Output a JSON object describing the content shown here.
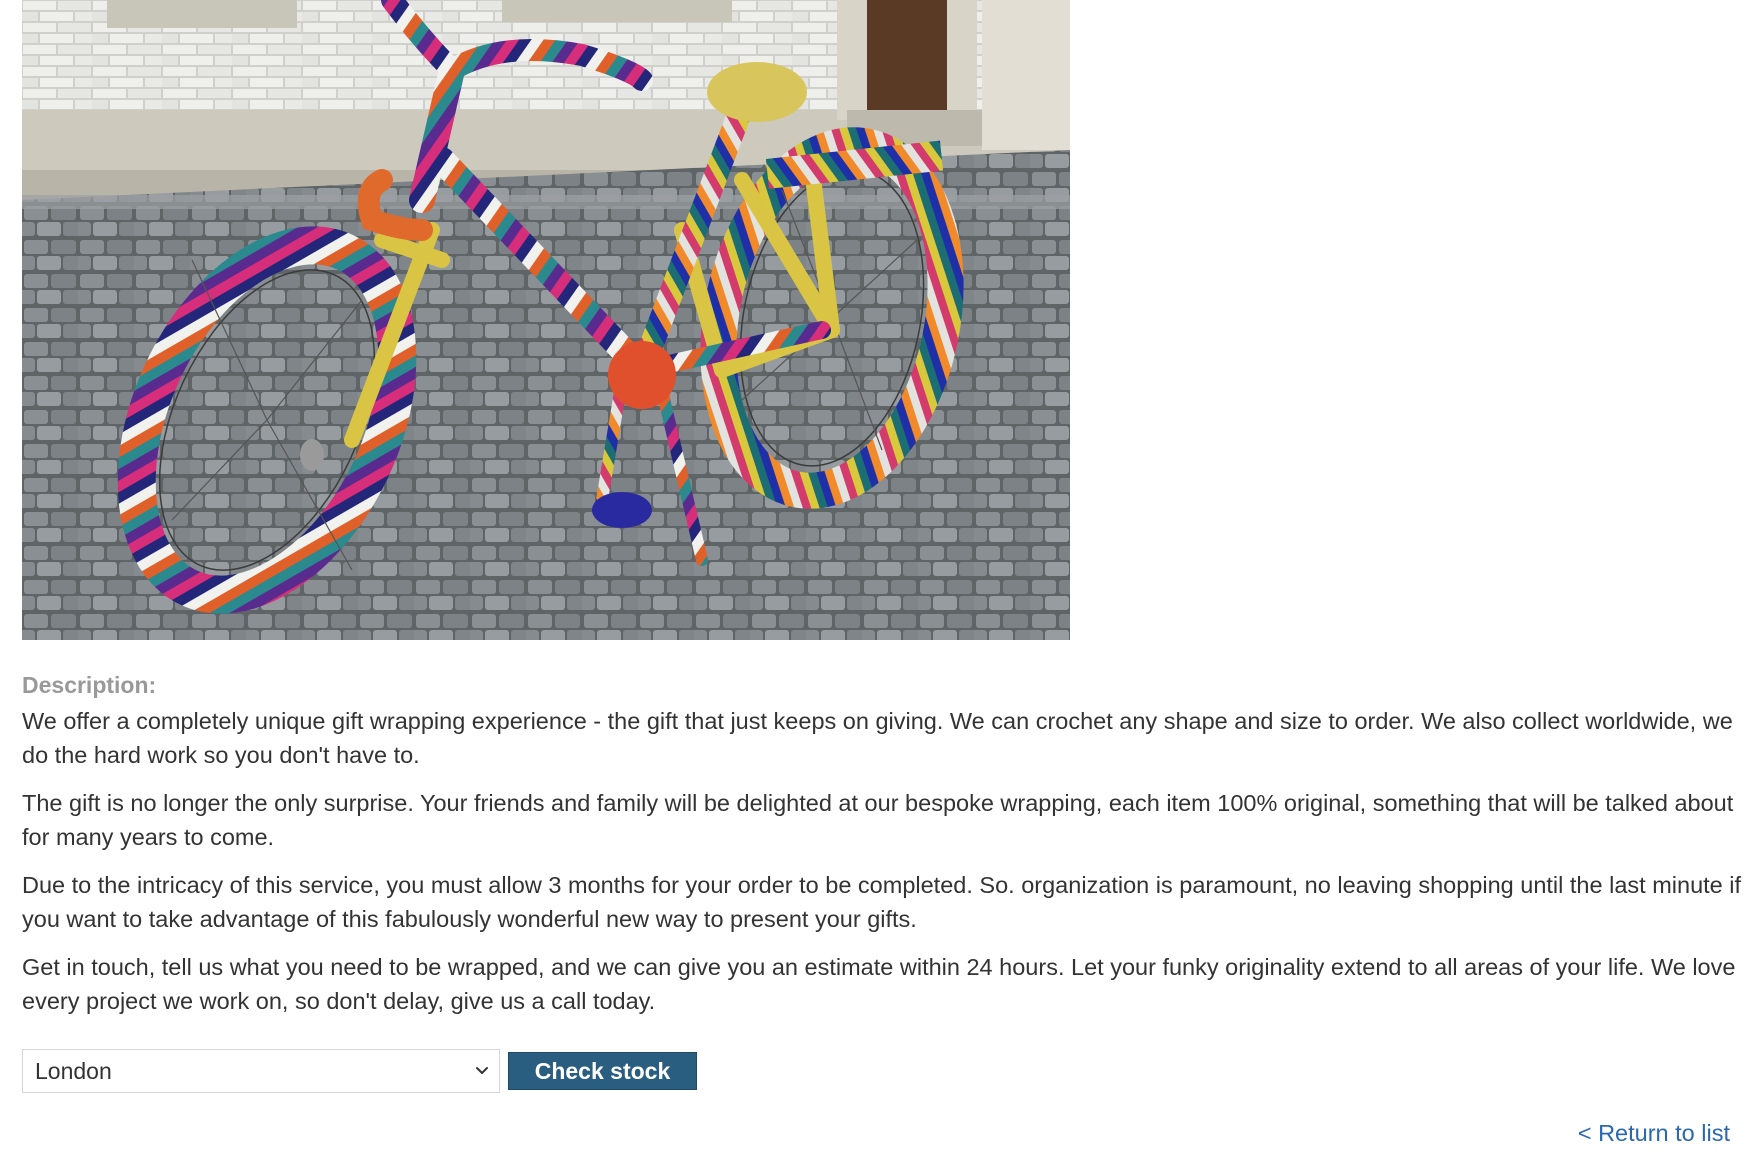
{
  "product": {
    "image_icon": "yarn-bombed-bicycle-photo",
    "description_heading": "Description:",
    "description_paragraphs": [
      "We offer a completely unique gift wrapping experience - the gift that just keeps on giving. We can crochet any shape and size to order. We also collect worldwide, we do the hard work so you don't have to.",
      "The gift is no longer the only surprise. Your friends and family will be delighted at our bespoke wrapping, each item 100% original, something that will be talked about for many years to come.",
      "Due to the intricacy of this service, you must allow 3 months for your order to be completed. So. organization is paramount, no leaving shopping until the last minute if you want to take advantage of this fabulously wonderful new way to present your gifts.",
      "Get in touch, tell us what you need to be wrapped, and we can give you an estimate within 24 hours. Let your funky originality extend to all areas of your life. We love every project we work on, so don't delay, give us a call today."
    ]
  },
  "stock_check": {
    "selected_store": "London",
    "button_label": "Check stock"
  },
  "navigation": {
    "return_link": "< Return to list"
  },
  "colors": {
    "button_bg": "#2a5e81",
    "link": "#2a68b0",
    "heading_gray": "#999999"
  }
}
